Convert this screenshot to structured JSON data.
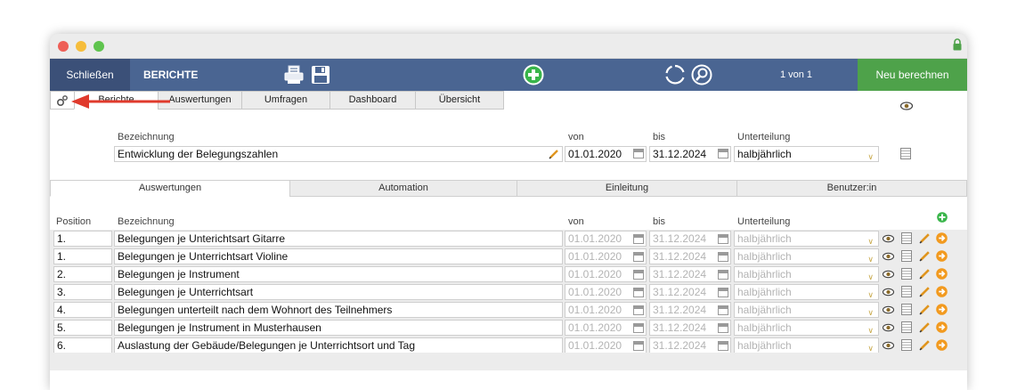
{
  "toolbar": {
    "close_label": "Schließen",
    "title": "BERICHTE",
    "page_indicator": "1 von 1",
    "recalc_label": "Neu berechnen"
  },
  "top_tabs": [
    "Berichte",
    "Auswertungen",
    "Umfragen",
    "Dashboard",
    "Übersicht"
  ],
  "form": {
    "bezeichnung_label": "Bezeichnung",
    "bezeichnung_value": "Entwicklung der Belegungszahlen",
    "von_label": "von",
    "von_value": "01.01.2020",
    "bis_label": "bis",
    "bis_value": "31.12.2024",
    "unterteilung_label": "Unterteilung",
    "unterteilung_value": "halbjährlich"
  },
  "mid_tabs": [
    "Auswertungen",
    "Automation",
    "Einleitung",
    "Benutzer:in"
  ],
  "grid": {
    "headers": {
      "position": "Position",
      "bezeichnung": "Bezeichnung",
      "von": "von",
      "bis": "bis",
      "unterteilung": "Unterteilung"
    },
    "rows": [
      {
        "position": "1.",
        "bezeichnung": "Belegungen je Unterichtsart Gitarre",
        "von": "01.01.2020",
        "bis": "31.12.2024",
        "unterteilung": "halbjährlich"
      },
      {
        "position": "1.",
        "bezeichnung": "Belegungen je Unterrichtsart Violine",
        "von": "01.01.2020",
        "bis": "31.12.2024",
        "unterteilung": "halbjährlich"
      },
      {
        "position": "2.",
        "bezeichnung": "Belegungen je Instrument",
        "von": "01.01.2020",
        "bis": "31.12.2024",
        "unterteilung": "halbjährlich"
      },
      {
        "position": "3.",
        "bezeichnung": "Belegungen je Unterrichtsart",
        "von": "01.01.2020",
        "bis": "31.12.2024",
        "unterteilung": "halbjährlich"
      },
      {
        "position": "4.",
        "bezeichnung": "Belegungen unterteilt nach dem Wohnort des Teilnehmers",
        "von": "01.01.2020",
        "bis": "31.12.2024",
        "unterteilung": "halbjährlich"
      },
      {
        "position": "5.",
        "bezeichnung": "Belegungen je Instrument in Musterhausen",
        "von": "01.01.2020",
        "bis": "31.12.2024",
        "unterteilung": "halbjährlich"
      },
      {
        "position": "6.",
        "bezeichnung": "Auslastung der Gebäude/Belegungen je Unterrichtsort und Tag",
        "von": "01.01.2020",
        "bis": "31.12.2024",
        "unterteilung": "halbjährlich"
      }
    ]
  },
  "colors": {
    "toolbar_bg": "#4a6592",
    "close_bg": "#3b5078",
    "recalc_bg": "#4ea24a",
    "add_green": "#39b54a",
    "arrow_red": "#e03a2c",
    "go_orange": "#f29a1f"
  },
  "icons": [
    "lock-icon",
    "print-icon",
    "save-icon",
    "add-icon",
    "refresh-icon",
    "search-icon",
    "gear-icon",
    "eye-icon",
    "list-icon",
    "calendar-icon",
    "pencil-icon",
    "arrow-right-circle-icon"
  ]
}
